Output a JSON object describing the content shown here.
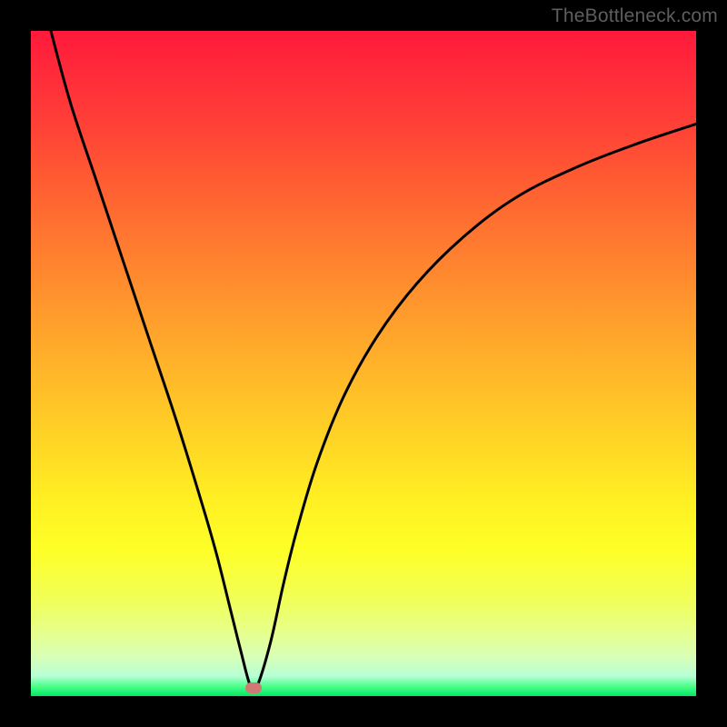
{
  "watermark": "TheBottleneck.com",
  "colors": {
    "frame": "#000000",
    "curve_stroke": "#000000",
    "dot_fill": "#cf7a77"
  },
  "chart_data": {
    "type": "line",
    "title": "",
    "xlabel": "",
    "ylabel": "",
    "xlim": [
      0,
      100
    ],
    "ylim": [
      0,
      100
    ],
    "grid": false,
    "legend": false,
    "annotations": [],
    "series": [
      {
        "name": "curve",
        "x": [
          3,
          6,
          10,
          14,
          18,
          22,
          26,
          28,
          30,
          31.5,
          33,
          34,
          36,
          38,
          40,
          43,
          47,
          52,
          58,
          65,
          73,
          82,
          91,
          100
        ],
        "y": [
          100,
          89,
          77,
          65,
          53,
          41,
          28,
          21,
          13,
          7,
          1.5,
          1.5,
          8,
          17,
          25,
          35,
          45,
          54,
          62,
          69,
          75,
          79.5,
          83,
          86
        ]
      }
    ],
    "marker": {
      "x": 33.5,
      "y": 1.2
    }
  }
}
